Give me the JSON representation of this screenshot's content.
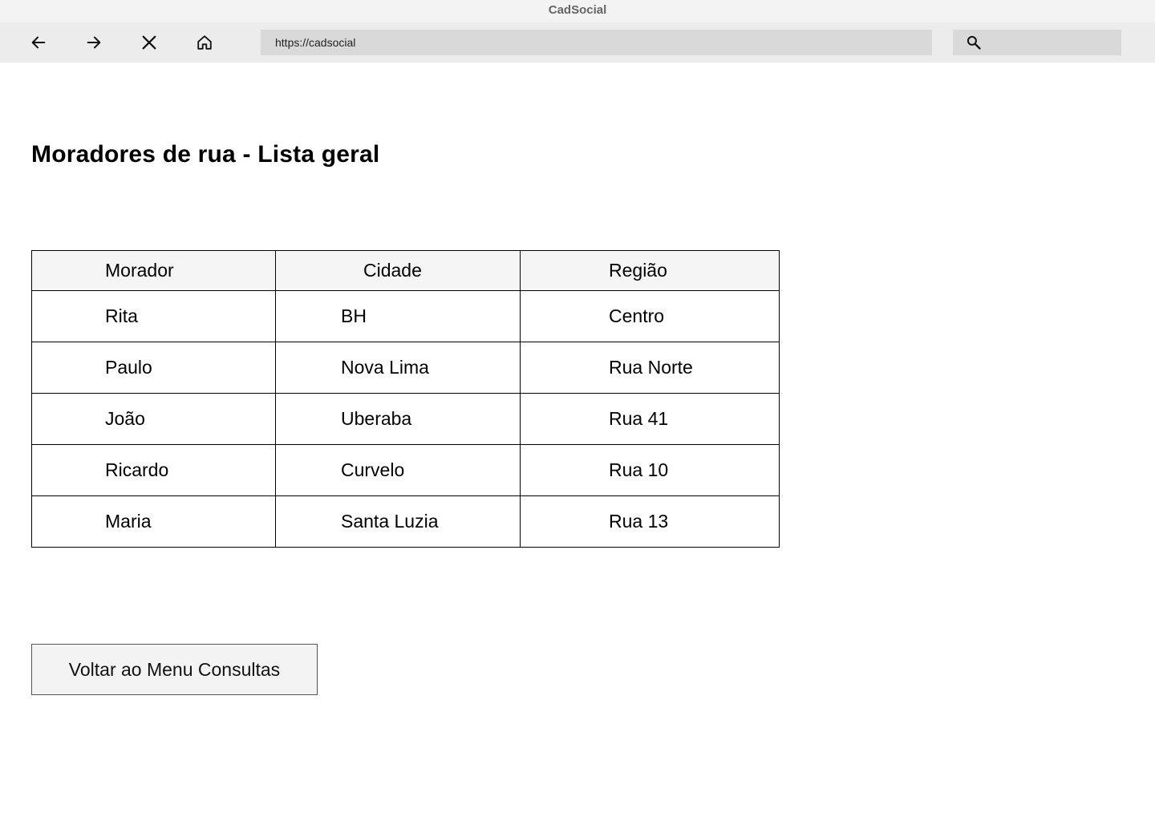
{
  "window": {
    "title": "CadSocial"
  },
  "toolbar": {
    "back_icon": "arrow-left-icon",
    "forward_icon": "arrow-right-icon",
    "stop_icon": "close-icon",
    "home_icon": "home-icon",
    "url": "https://cadsocial",
    "search_icon": "search-icon",
    "search_value": ""
  },
  "page": {
    "title": "Moradores de rua - Lista geral",
    "table": {
      "headers": [
        "Morador",
        "Cidade",
        "Região"
      ],
      "rows": [
        [
          "Rita",
          "BH",
          "Centro"
        ],
        [
          "Paulo",
          "Nova Lima",
          "Rua Norte"
        ],
        [
          "João",
          "Uberaba",
          "Rua 41"
        ],
        [
          "Ricardo",
          "Curvelo",
          "Rua 10"
        ],
        [
          "Maria",
          "Santa Luzia",
          "Rua 13"
        ]
      ]
    },
    "back_button_label": "Voltar ao Menu Consultas"
  }
}
